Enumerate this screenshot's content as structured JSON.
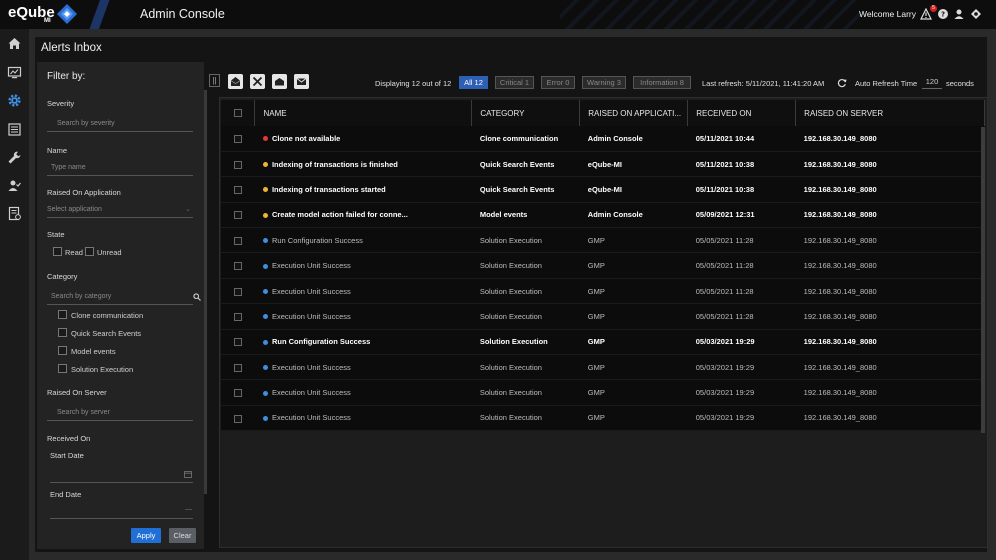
{
  "header": {
    "logo_text": "eQube",
    "logo_sub": "MI",
    "app_title": "Admin Console",
    "welcome": "Welcome Larry",
    "notification_count": "5",
    "icons": [
      "warning-icon",
      "help-icon",
      "user-icon",
      "settings-icon"
    ]
  },
  "nav": {
    "icons": [
      "home-icon",
      "monitor-icon",
      "gear-icon",
      "list-icon",
      "wrench-icon",
      "user-check-icon",
      "report-icon"
    ],
    "active": "gear-icon"
  },
  "page": {
    "title": "Alerts Inbox"
  },
  "filter": {
    "title": "Filter by:",
    "severity_label": "Severity",
    "severity_placeholder": "Search by severity",
    "name_label": "Name",
    "name_placeholder": "Type name",
    "app_label": "Raised On Application",
    "app_placeholder": "Select application",
    "state_label": "State",
    "state_options": [
      "Read",
      "Unread"
    ],
    "category_label": "Category",
    "category_placeholder": "Search by category",
    "category_options": [
      "Clone communication",
      "Quick Search Events",
      "Model events",
      "Solution Execution"
    ],
    "server_label": "Raised On Server",
    "server_placeholder": "Search by server",
    "received_label": "Received On",
    "start_label": "Start Date",
    "end_label": "End Date",
    "apply_label": "Apply",
    "clear_label": "Clear"
  },
  "toolbar": {
    "display_text": "Displaying 12 out of 12",
    "chips": [
      {
        "label": "All 12",
        "active": true
      },
      {
        "label": "Critical 1",
        "active": false
      },
      {
        "label": "Error 0",
        "active": false
      },
      {
        "label": "Warning 3",
        "active": false
      },
      {
        "label": "Information 8",
        "active": false
      }
    ],
    "last_refresh": "Last refresh: 5/11/2021, 11:41:20 AM",
    "auto_refresh_label": "Auto Refresh Time",
    "auto_refresh_value": "120",
    "auto_refresh_unit": "seconds"
  },
  "grid": {
    "columns": [
      "NAME",
      "CATEGORY",
      "RAISED ON APPLICATI...",
      "RECEIVED ON",
      "RAISED ON SERVER"
    ],
    "rows": [
      {
        "severity": "critical",
        "name": "Clone not available",
        "category": "Clone communication",
        "app": "Admin Console",
        "received": "05/11/2021 10:44",
        "server": "192.168.30.149_8080",
        "unread": true
      },
      {
        "severity": "warning",
        "name": "Indexing of transactions is finished",
        "category": "Quick Search Events",
        "app": "eQube-MI",
        "received": "05/11/2021 10:38",
        "server": "192.168.30.149_8080",
        "unread": true
      },
      {
        "severity": "warning",
        "name": "Indexing of transactions started",
        "category": "Quick Search Events",
        "app": "eQube-MI",
        "received": "05/11/2021 10:38",
        "server": "192.168.30.149_8080",
        "unread": true
      },
      {
        "severity": "warning",
        "name": "Create model action failed for conne...",
        "category": "Model events",
        "app": "Admin Console",
        "received": "05/09/2021 12:31",
        "server": "192.168.30.149_8080",
        "unread": true
      },
      {
        "severity": "info",
        "name": "Run Configuration Success",
        "category": "Solution Execution",
        "app": "GMP",
        "received": "05/05/2021 11:28",
        "server": "192.168.30.149_8080",
        "unread": false
      },
      {
        "severity": "info",
        "name": "Execution Unit Success",
        "category": "Solution Execution",
        "app": "GMP",
        "received": "05/05/2021 11:28",
        "server": "192.168.30.149_8080",
        "unread": false
      },
      {
        "severity": "info",
        "name": "Execution Unit Success",
        "category": "Solution Execution",
        "app": "GMP",
        "received": "05/05/2021 11:28",
        "server": "192.168.30.149_8080",
        "unread": false
      },
      {
        "severity": "info",
        "name": "Execution Unit Success",
        "category": "Solution Execution",
        "app": "GMP",
        "received": "05/05/2021 11:28",
        "server": "192.168.30.149_8080",
        "unread": false
      },
      {
        "severity": "info",
        "name": "Run Configuration Success",
        "category": "Solution Execution",
        "app": "GMP",
        "received": "05/03/2021 19:29",
        "server": "192.168.30.149_8080",
        "unread": true
      },
      {
        "severity": "info",
        "name": "Execution Unit Success",
        "category": "Solution Execution",
        "app": "GMP",
        "received": "05/03/2021 19:29",
        "server": "192.168.30.149_8080",
        "unread": false
      },
      {
        "severity": "info",
        "name": "Execution Unit Success",
        "category": "Solution Execution",
        "app": "GMP",
        "received": "05/03/2021 19:29",
        "server": "192.168.30.149_8080",
        "unread": false
      },
      {
        "severity": "info",
        "name": "Execution Unit Success",
        "category": "Solution Execution",
        "app": "GMP",
        "received": "05/03/2021 19:29",
        "server": "192.168.30.149_8080",
        "unread": false
      }
    ]
  },
  "colors": {
    "critical": "#e53935",
    "warning": "#f2b233",
    "info": "#3d8fe0",
    "accent": "#2d5fb5",
    "apply": "#1f6fd6"
  }
}
